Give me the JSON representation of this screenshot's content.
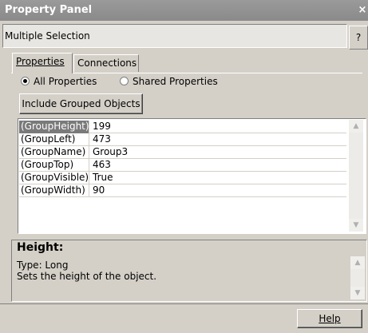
{
  "window": {
    "title": "Property Panel",
    "close_glyph": "×"
  },
  "selection": {
    "text": "Multiple Selection",
    "help_glyph": "?"
  },
  "tabs": [
    {
      "label": "Properties",
      "active": true
    },
    {
      "label": "Connections",
      "active": false
    }
  ],
  "filter": {
    "all_label": "All Properties",
    "shared_label": "Shared Properties",
    "selected": "all"
  },
  "include_button": {
    "label": "Include Grouped Objects"
  },
  "properties": [
    {
      "name": "(GroupHeight)",
      "value": "199",
      "selected": true
    },
    {
      "name": "(GroupLeft)",
      "value": "473",
      "selected": false
    },
    {
      "name": "(GroupName)",
      "value": "Group3",
      "selected": false
    },
    {
      "name": "(GroupTop)",
      "value": "463",
      "selected": false
    },
    {
      "name": "(GroupVisible)",
      "value": "True",
      "selected": false
    },
    {
      "name": "(GroupWidth)",
      "value": "90",
      "selected": false
    }
  ],
  "info": {
    "title": "Height:",
    "type_line": "Type: Long",
    "description": "Sets the height of the object."
  },
  "footer": {
    "help_label": "Help"
  },
  "icons": {
    "scroll_up": "chevron-up-icon",
    "scroll_down": "chevron-down-icon"
  }
}
